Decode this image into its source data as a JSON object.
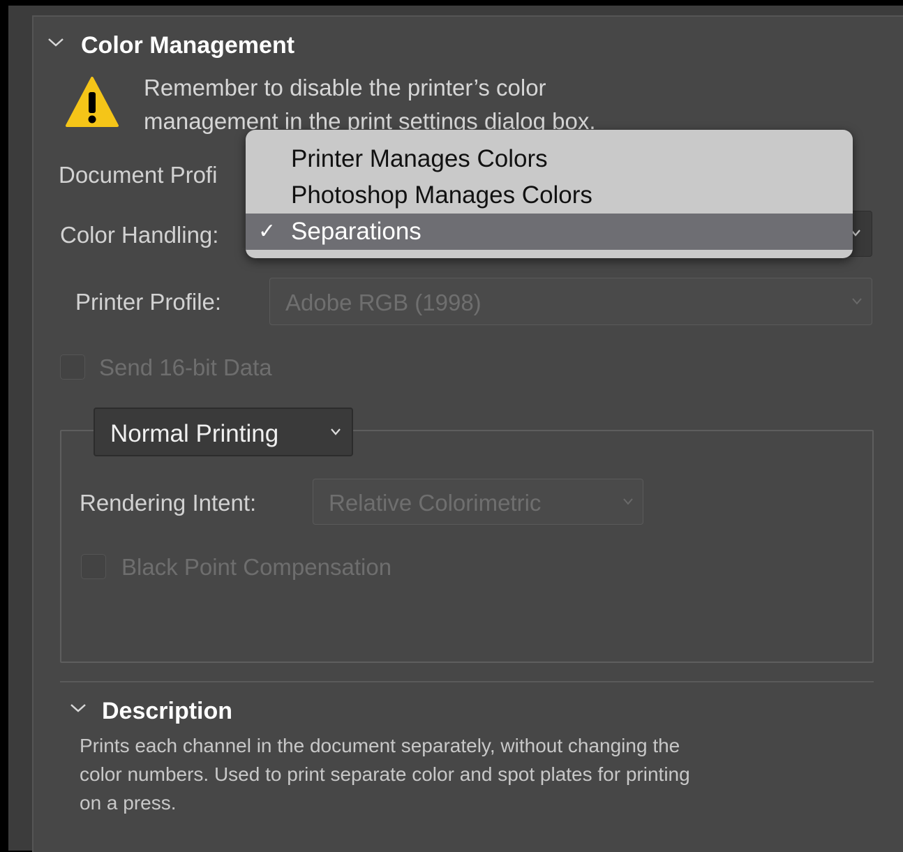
{
  "color_management": {
    "title": "Color Management",
    "warning_line1": "Remember to disable the printer’s color",
    "warning_line2": "management in the print settings dialog box.",
    "document_profile_label": "Document Profi",
    "color_handling_label": "Color Handling:",
    "color_handling_menu": {
      "options": [
        "Printer Manages Colors",
        "Photoshop Manages Colors",
        "Separations"
      ],
      "selected": "Separations",
      "check_glyph": "✓"
    },
    "printer_profile_label": "Printer Profile:",
    "printer_profile_value": "Adobe RGB (1998)",
    "send_16bit_label": "Send 16-bit Data",
    "send_16bit_checked": false,
    "printing_mode_value": "Normal Printing",
    "rendering_intent_label": "Rendering Intent:",
    "rendering_intent_value": "Relative Colorimetric",
    "black_point_label": "Black Point Compensation",
    "black_point_checked": false
  },
  "description": {
    "title": "Description",
    "line1": "Prints each channel in the document separately, without changing the",
    "line2": "color numbers. Used to print separate color and spot plates for printing",
    "line3": "on a press."
  },
  "colors": {
    "warning_yellow": "#f5c518",
    "menu_bg": "#c9c9c9",
    "menu_selected": "#6e6e73"
  },
  "icons": {
    "chevron": "chevron-down-icon",
    "warning": "warning-icon",
    "checkmark": "checkmark-icon"
  }
}
